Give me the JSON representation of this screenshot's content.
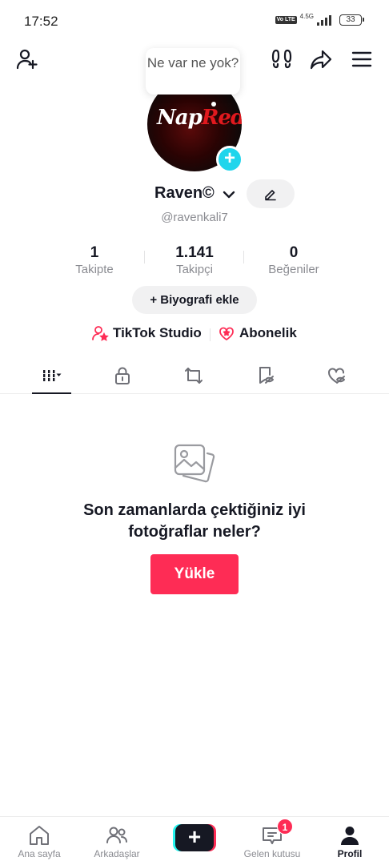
{
  "status_bar": {
    "time": "17:52",
    "volte": "Vo LTE",
    "network": "4.5G",
    "battery": "33"
  },
  "header": {
    "note_bubble": "Ne var ne yok?"
  },
  "avatar": {
    "logo_part1": "Nap",
    "logo_part2": "Red",
    "add_symbol": "+"
  },
  "profile": {
    "display_name": "Raven©",
    "username": "@ravenkali7"
  },
  "stats": [
    {
      "value": "1",
      "label": "Takipte"
    },
    {
      "value": "1.141",
      "label": "Takipçi"
    },
    {
      "value": "0",
      "label": "Beğeniler"
    }
  ],
  "bio_button": "+ Biyografi ekle",
  "links": {
    "studio": "TikTok Studio",
    "subscription": "Abonelik"
  },
  "tabs": [
    {
      "icon": "grid-icon",
      "active": true
    },
    {
      "icon": "lock-icon",
      "active": false
    },
    {
      "icon": "repost-icon",
      "active": false
    },
    {
      "icon": "bookmark-hidden-icon",
      "active": false
    },
    {
      "icon": "liked-hidden-icon",
      "active": false
    }
  ],
  "empty_state": {
    "line1": "Son zamanlarda çektiğiniz iyi",
    "line2": "fotoğraflar neler?",
    "button": "Yükle"
  },
  "bottom_nav": {
    "home": "Ana sayfa",
    "friends": "Arkadaşlar",
    "create": "+",
    "inbox": "Gelen kutusu",
    "inbox_badge": "1",
    "profile": "Profil"
  },
  "colors": {
    "accent": "#fe2c55",
    "cyan": "#20d5ec",
    "text": "#161823",
    "muted": "#8a8b91"
  }
}
